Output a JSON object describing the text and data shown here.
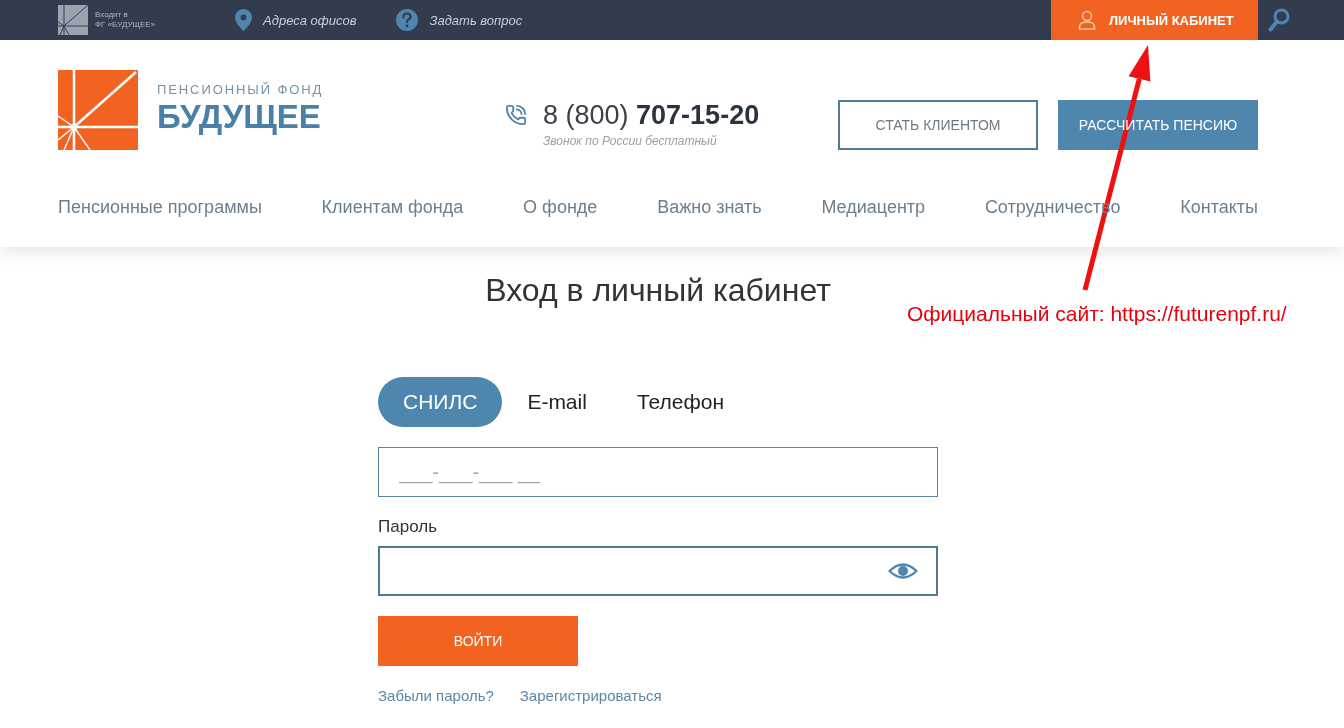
{
  "top_bar": {
    "group_caption_lines": [
      "Входит в",
      "ФГ «БУДУЩЕЕ»"
    ],
    "links": [
      {
        "label": "Адреса офисов",
        "kind": "location"
      },
      {
        "label": "Задать вопрос",
        "kind": "question"
      }
    ],
    "account_button": "ЛИЧНЫЙ КАБИНЕТ"
  },
  "header": {
    "logo": {
      "tagline": "ПЕНСИОННЫЙ ФОНД",
      "name": "БУДУЩЕЕ"
    },
    "phone": {
      "number": "8 (800) **707-15-20**",
      "note": "Звонок по России бесплатный"
    },
    "buttons": [
      {
        "label": "СТАТЬ КЛИЕНТОМ",
        "kind": "outline"
      },
      {
        "label": "РАССЧИТАТЬ ПЕНСИЮ",
        "kind": "filled"
      }
    ],
    "nav": [
      "Пенсионные программы",
      "Клиентам фонда",
      "О фонде",
      "Важно знать",
      "Медиацентр",
      "Сотрудничество",
      "Контакты"
    ]
  },
  "login": {
    "title": "Вход в личный кабинет",
    "tabs": [
      {
        "label": "СНИЛС",
        "selected": true
      },
      {
        "label": "E-mail",
        "selected": false
      },
      {
        "label": "Телефон",
        "selected": false
      }
    ],
    "login_field": {
      "placeholder": "___-___-___ __"
    },
    "password_field": {
      "label": "Пароль"
    },
    "submit": "ВОЙТИ",
    "links": [
      "Забыли пароль?",
      "Зарегистрироваться"
    ]
  },
  "annotation": {
    "text": "Официальный сайт: https://futurenpf.ru/"
  }
}
